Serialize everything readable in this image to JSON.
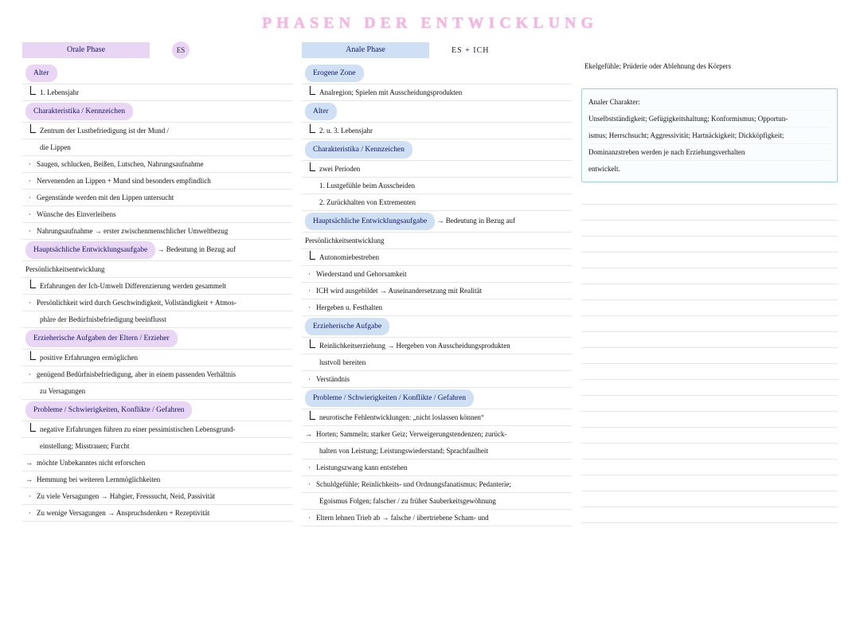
{
  "title": "PHASEN DER ENTWICKLUNG",
  "col1": {
    "ribbon": "Orale Phase",
    "badge": "ES",
    "s1": {
      "label": "Alter",
      "l1": "1. Lebensjahr"
    },
    "s2": {
      "label": "Charakteristika / Kennzeichen",
      "l1": "Zentrum der Lustbefriedigung ist der Mund /",
      "l2": "die Lippen",
      "l3": "Saugen, schlucken, Beißen, Lutschen, Nahrungsaufnahme",
      "l4": "Nervenenden an Lippen + Mund sind besonders empfindlich",
      "l5": "Gegenstände werden mit den Lippen untersucht",
      "l6": "Wünsche des Einverleibens",
      "l7": "Nahrungsaufnahme → erster zwischenmenschlicher Umweltbezug"
    },
    "s3": {
      "label": "Hauptsächliche Entwicklungsaufgabe",
      "after": "→ Bedeutung in Bezug auf",
      "l1": "Persönlichkeitsentwicklung",
      "l2": "Erfahrungen der Ich-Umwelt Differenzierung werden gesammelt",
      "l3": "Persönlichkeit wird durch Geschwindigkeit, Vollständigkeit + Atmos-",
      "l4": "phäre der Bedürfnisbefriedigung beeinflusst"
    },
    "s4": {
      "label": "Erzieherische Aufgaben der Eltern / Erzieher",
      "l1": "positive Erfahrungen ermöglichen",
      "l2": "genügend Bedürfnisbefriedigung, aber in einem passenden Verhältnis",
      "l3": "zu Versagungen"
    },
    "s5": {
      "label": "Probleme / Schwierigkeiten, Konflikte / Gefahren",
      "l1": "negative Erfahrungen führen zu einer pessimistischen Lebensgrund-",
      "l2": "einstellung; Misstrauen; Furcht",
      "l3": "möchte Unbekanntes nicht erforschen",
      "l4": "Hemmung bei weiteren Lernmöglichkeiten",
      "l5": "Zu viele Versagungen → Habgier, Fresssucht, Neid, Passivität",
      "l6": "Zu wenige Versagungen → Anspruchsdenken + Rezeptivität"
    }
  },
  "col2": {
    "ribbon": "Anale Phase",
    "tag": "ES + ICH",
    "s1": {
      "label": "Erogene Zone",
      "l1": "Analregion; Spielen mit Ausscheidungsprodukten"
    },
    "s2": {
      "label": "Alter",
      "l1": "2. u. 3. Lebensjahr"
    },
    "s3": {
      "label": "Charakteristika / Kennzeichen",
      "l1": "zwei Perioden",
      "l2": "1. Lustgefühle beim Ausscheiden",
      "l3": "2. Zurückhalten von Extrementen"
    },
    "s4": {
      "label": "Hauptsächliche Entwicklungsaufgabe",
      "after": "→ Bedeutung in Bezug auf",
      "l1": "Persönlichkeitsentwicklung",
      "l2": "Autonomiebestreben",
      "l3": "Wiederstand und Gehorsamkeit",
      "l4": "ICH wird ausgebildet → Auseinandersetzung mit Realität",
      "l5": "Hergeben u. Festhalten"
    },
    "s5": {
      "label": "Erzieherische Aufgabe",
      "l1": "Reinlichkeitserziehung → Hergeben von Ausscheidungsprodukten",
      "l2": "lustvoll bereiten",
      "l3": "Verständnis"
    },
    "s6": {
      "label": "Probleme / Schwierigkeiten / Konflikte / Gefahren",
      "l1": "neurotische Fehlentwicklungen: „nicht loslassen können“",
      "l2": "Horten; Sammeln; starker Geiz; Verweigerungstendenzen; zurück-",
      "l3": "halten von Leistung; Leistungswiederstand; Sprachfaulheit",
      "l4": "Leistungszwang kann entstehen",
      "l5": "Schuldgefühle; Reinlichkeits- und Ordnungsfanatismus; Pedanterie;",
      "l6": "Egoismus Folgen; falscher / zu früher Sauberkeitsgewöhnung",
      "l7": "Eltern lehnen Trieb ab → falsche / übertriebene Scham- und"
    }
  },
  "col3": {
    "top": "Ekelgefühle; Prüderie oder Ablehnung des Körpers",
    "box": {
      "l1": "Analer Charakter:",
      "l2": "Unselbstständigkeit; Gefügigkeitshaltung; Konformismus; Opportun-",
      "l3": "ismus; Herrschsucht; Aggressivität; Hartnäckigkeit; Dickköpfigkeit;",
      "l4": "Dominanzstreben werden je nach Erziehungsverhalten",
      "l5": "entwickelt."
    }
  }
}
